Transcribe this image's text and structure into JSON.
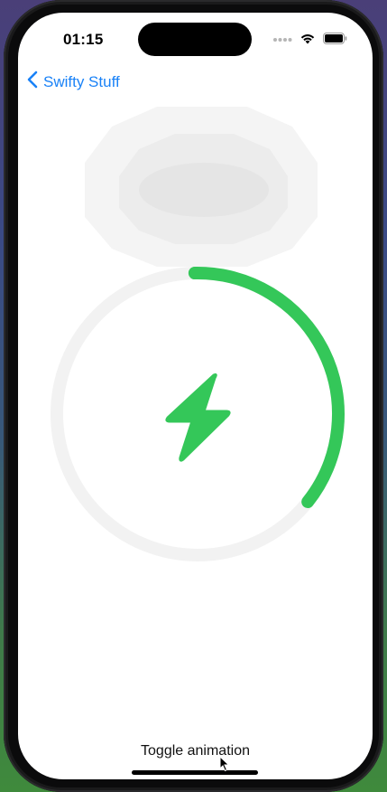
{
  "status_bar": {
    "time": "01:15"
  },
  "nav": {
    "back_label": "Swifty Stuff"
  },
  "charging": {
    "progress_fraction": 0.36,
    "accent_color": "#34c759",
    "track_color": "#f2f2f2",
    "icon": "bolt-icon"
  },
  "footer": {
    "toggle_label": "Toggle animation"
  },
  "colors": {
    "link": "#1a82f7"
  }
}
